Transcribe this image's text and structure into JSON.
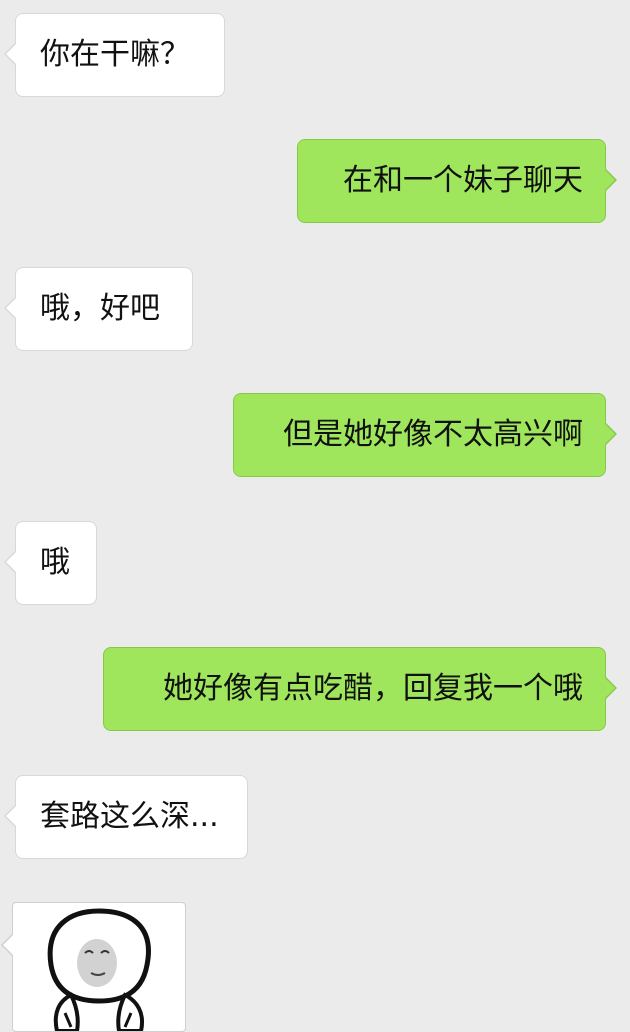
{
  "messages": [
    {
      "side": "in",
      "text": "你在干嘛？"
    },
    {
      "side": "out",
      "text": "在和一个妹子聊天"
    },
    {
      "side": "in",
      "text": "哦，好吧"
    },
    {
      "side": "out",
      "text": "但是她好像不太高兴啊"
    },
    {
      "side": "in",
      "text": "哦"
    },
    {
      "side": "out",
      "text": "她好像有点吃醋，回复我一个哦"
    },
    {
      "side": "in",
      "text": "套路这么深..."
    }
  ],
  "sticker": {
    "icon": "panda-meme-face-icon"
  },
  "colors": {
    "background": "#ebebeb",
    "incoming_bubble": "#ffffff",
    "outgoing_bubble": "#9fe65c"
  }
}
